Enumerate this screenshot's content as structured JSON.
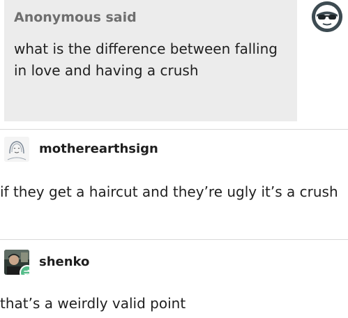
{
  "ask": {
    "asker": "Anonymous said",
    "question": "what is the difference between falling in love and having a crush",
    "avatar_icon": "anonymous-glasses-icon"
  },
  "replies": [
    {
      "username": "motherearthsign",
      "avatar_icon": "sketched-face-avatar",
      "text": "if they get a haircut and they’re ugly it’s a crush"
    },
    {
      "username": "shenko",
      "avatar_icon": "photo-avatar",
      "badge_icon": "reblog-icon",
      "text": "that’s a weirdly valid point"
    }
  ],
  "colors": {
    "ask_background": "#ececec",
    "reblog_badge": "#56bc8a"
  }
}
